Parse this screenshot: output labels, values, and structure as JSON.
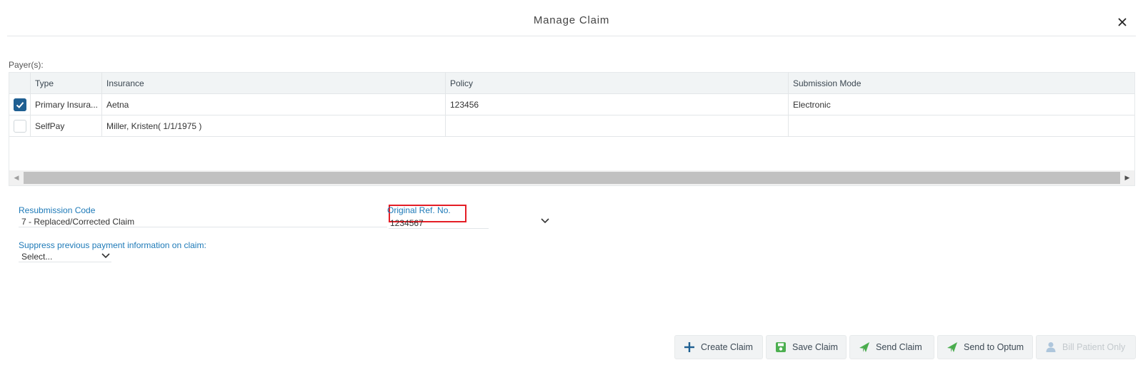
{
  "dialog": {
    "title": "Manage Claim",
    "close_icon": "close-icon"
  },
  "payers": {
    "label": "Payer(s):",
    "columns": [
      "Type",
      "Insurance",
      "Policy",
      "Submission Mode"
    ],
    "rows": [
      {
        "checked": true,
        "type": "Primary Insura...",
        "insurance": "Aetna",
        "policy": "123456",
        "submission_mode": "Electronic"
      },
      {
        "checked": false,
        "type": "SelfPay",
        "insurance": "Miller, Kristen( 1/1/1975 )",
        "policy": "",
        "submission_mode": ""
      }
    ],
    "scrollbar_icons": [
      "scroll-left-arrow-icon",
      "scroll-right-arrow-icon"
    ]
  },
  "form": {
    "resubmission_code": {
      "label": "Resubmission Code",
      "value": "7 - Replaced/Corrected Claim"
    },
    "original_ref": {
      "label": "Original Ref. No.",
      "value": "1234567"
    },
    "suppress": {
      "label": "Suppress previous payment information on claim:",
      "value": "Select..."
    }
  },
  "buttons": {
    "create_claim": "Create Claim",
    "save_claim": "Save Claim",
    "send_claim": "Send Claim",
    "send_to_optum": "Send to Optum",
    "bill_patient_only": "Bill Patient Only"
  },
  "colors": {
    "accent": "#1e7ab8",
    "checkbox": "#1f5f92",
    "highlight_box": "#e41e26",
    "send_icon": "#4caf50",
    "create_icon": "#1f5f92"
  }
}
